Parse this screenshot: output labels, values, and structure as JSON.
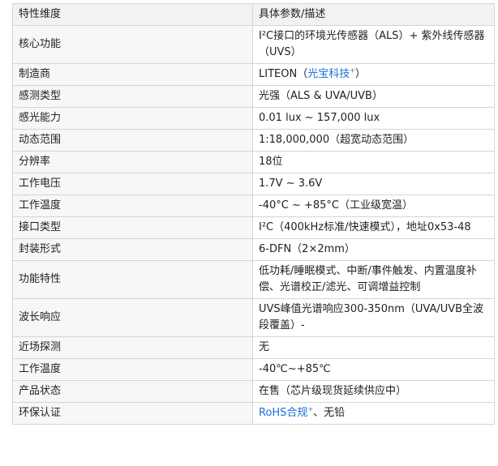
{
  "table": {
    "headers": [
      "特性维度",
      "具体参数/描述"
    ],
    "rows": [
      {
        "param": "核心功能",
        "value": "I²C接口的环境光传感器（ALS）+ 紫外线传感器（UVS）"
      },
      {
        "param": "制造商",
        "value_prefix": "LITEON（",
        "value_link": "光宝科技",
        "value_link_mark": "+",
        "value_suffix": "）"
      },
      {
        "param": "感测类型",
        "value": "光强（ALS & UVA/UVB）"
      },
      {
        "param": "感光能力",
        "value": "0.01 lux ~ 157,000 lux"
      },
      {
        "param": "动态范围",
        "value": "1:18,000,000（超宽动态范围）"
      },
      {
        "param": "分辨率",
        "value": "18位"
      },
      {
        "param": "工作电压",
        "value": "1.7V ~ 3.6V"
      },
      {
        "param": "工作温度",
        "value": "-40°C ~ +85°C（工业级宽温）"
      },
      {
        "param": "接口类型",
        "value": "I²C（400kHz标准/快速模式），地址0x53-48"
      },
      {
        "param": "封装形式",
        "value": "6-DFN（2×2mm）"
      },
      {
        "param": "功能特性",
        "value": "低功耗/睡眠模式、中断/事件触发、内置温度补偿、光谱校正/滤光、可调增益控制"
      },
      {
        "param": "波长响应",
        "value": "UVS峰值光谱响应300-350nm（UVA/UVB全波段覆盖）-"
      },
      {
        "param": "近场探测",
        "value": "无"
      },
      {
        "param": "工作温度",
        "value": "-40℃~+85℃"
      },
      {
        "param": "产品状态",
        "value": "在售（芯片级现货延续供应中）"
      },
      {
        "param": "环保认证",
        "value_link": "RoHS合规",
        "value_link_mark": "+",
        "value_suffix": "、无铅"
      }
    ]
  }
}
